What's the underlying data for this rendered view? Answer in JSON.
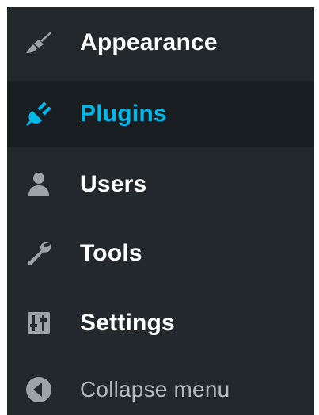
{
  "menu": {
    "items": [
      {
        "label": "Appearance",
        "icon": "paintbrush-icon",
        "active": false
      },
      {
        "label": "Plugins",
        "icon": "plugin-plug-icon",
        "active": true
      },
      {
        "label": "Users",
        "icon": "user-icon",
        "active": false
      },
      {
        "label": "Tools",
        "icon": "wrench-icon",
        "active": false
      },
      {
        "label": "Settings",
        "icon": "settings-sliders-icon",
        "active": false
      }
    ],
    "collapse_label": "Collapse menu",
    "collapse_icon": "arrow-left-circle-icon"
  },
  "colors": {
    "menu_background": "#23282d",
    "active_background": "#191e23",
    "active_text": "#00b9eb",
    "text": "#ffffff",
    "icon": "#9ea3a8",
    "muted_text": "#b4b9be"
  }
}
